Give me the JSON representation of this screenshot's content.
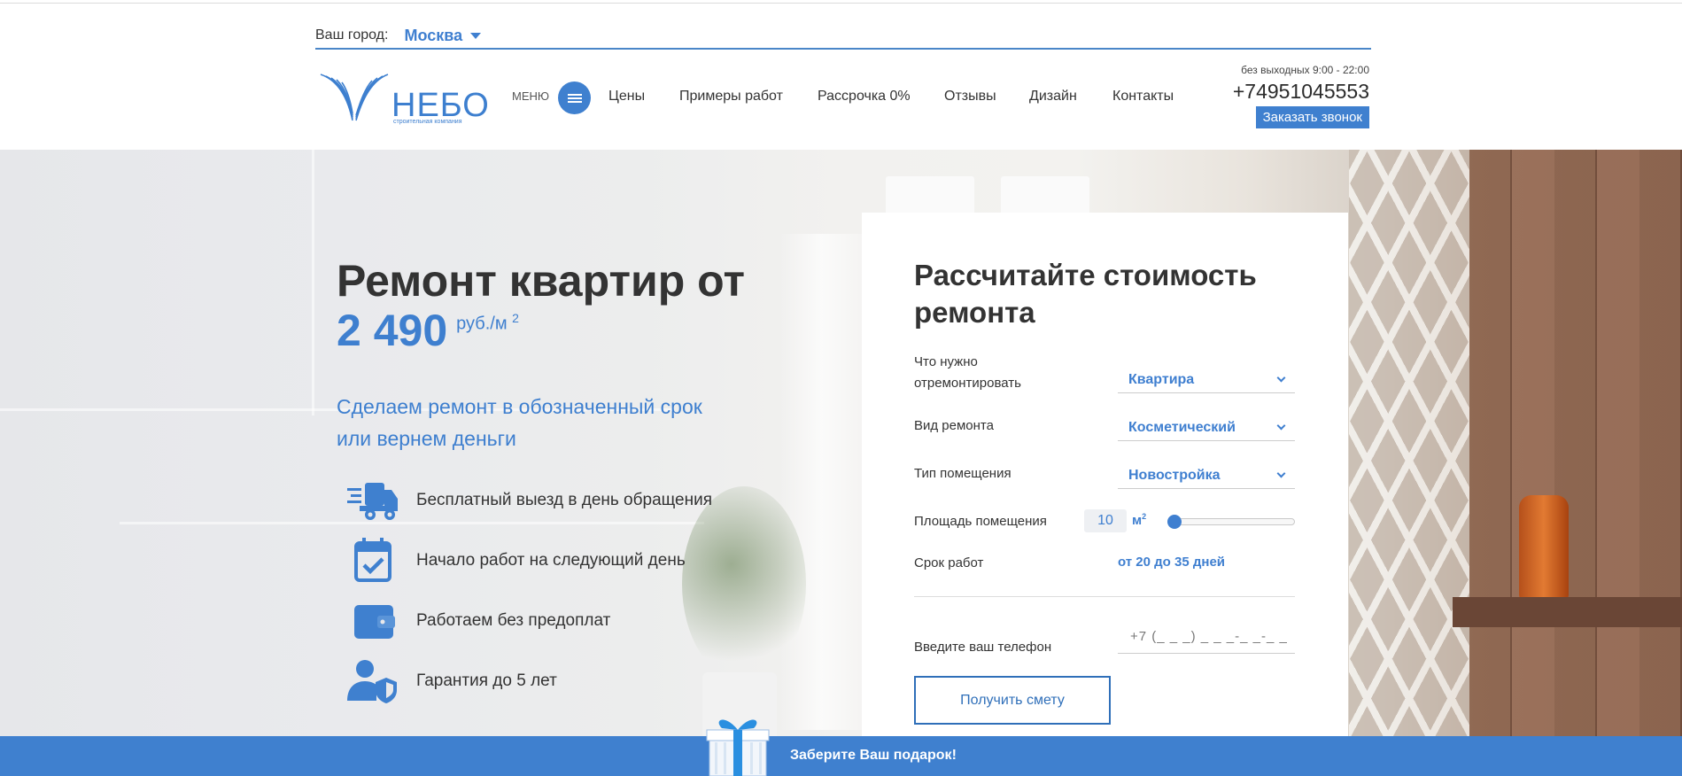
{
  "header": {
    "city_label": "Ваш город:",
    "city_value": "Москва",
    "logo_text": "НЕБО",
    "logo_subtitle": "строительная компания",
    "menu_label": "МЕНЮ",
    "nav": [
      "Цены",
      "Примеры работ",
      "Рассрочка 0%",
      "Отзывы",
      "Дизайн",
      "Контакты"
    ],
    "hours": "без выходных 9:00 - 22:00",
    "phone": "+74951045553",
    "callback_label": "Заказать звонок"
  },
  "hero": {
    "title": "Ремонт квартир от",
    "price": "2 490",
    "price_unit": "руб./м",
    "price_unit_sup": "2",
    "subtitle": "Сделаем ремонт в обозначенный срок или вернем деньги",
    "features": [
      {
        "icon": "delivery-truck-icon",
        "text": "Бесплатный выезд в день обращения"
      },
      {
        "icon": "calendar-check-icon",
        "text": "Начало работ на следующий день"
      },
      {
        "icon": "wallet-icon",
        "text": "Работаем без предоплат"
      },
      {
        "icon": "user-shield-icon",
        "text": "Гарантия до 5 лет"
      }
    ]
  },
  "calculator": {
    "title": "Рассчитайте стоимость ремонта",
    "what_label": "Что нужно отремонтировать",
    "what_value": "Квартира",
    "type_label": "Вид ремонта",
    "type_value": "Косметический",
    "room_label": "Тип помещения",
    "room_value": "Новостройка",
    "area_label": "Площадь помещения",
    "area_value": "10",
    "area_unit": "м",
    "area_unit_sup": "2",
    "area_slider_fraction": 0.05,
    "term_label": "Срок работ",
    "term_value": "от 20 до 35 дней",
    "phone_label": "Введите ваш телефон",
    "phone_placeholder": "+7 (_ _ _) _ _ _-_ _-_ _",
    "submit_label": "Получить смету"
  },
  "gift_bar": {
    "text": "Заберите Ваш подарок!"
  },
  "colors": {
    "accent": "#3f80cf",
    "text": "#333333"
  }
}
